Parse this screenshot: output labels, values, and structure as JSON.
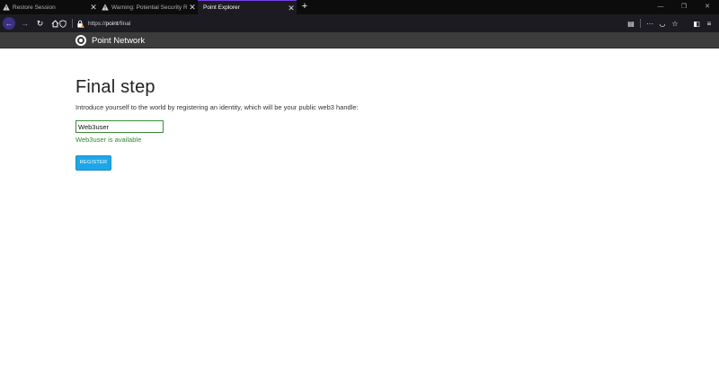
{
  "browser": {
    "tabs": [
      {
        "label": "Restore Session",
        "icon": "warning-icon",
        "active": false
      },
      {
        "label": "Warning: Potential Security Ri",
        "icon": "warning-icon",
        "active": false
      },
      {
        "label": "Point Explorer",
        "icon": "",
        "active": true
      }
    ],
    "new_tab_label": "+",
    "url_prefix": "https://",
    "url_host": "point",
    "url_path": "/final"
  },
  "site": {
    "brand": "Point Network"
  },
  "main": {
    "title": "Final step",
    "intro": "Introduce yourself to the world by registering an identity, which will be your public web3 handle:",
    "identity_value": "Web3user",
    "availability": "Web3user is available",
    "register_label": "REGISTER"
  },
  "colors": {
    "accent": "#1ea7e8",
    "success": "#2a8a2a",
    "header_bg": "#3c3c3c"
  }
}
